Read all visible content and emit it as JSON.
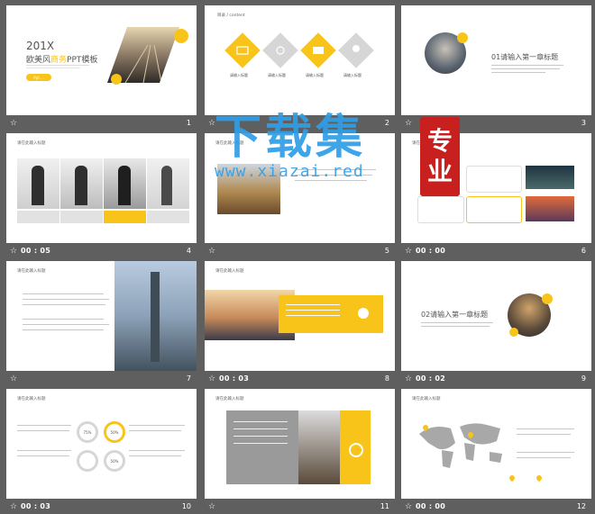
{
  "slides": [
    {
      "number": "1",
      "time": "",
      "title_year": "201X",
      "subtitle_pre": "欧美风",
      "subtitle_hl": "商务",
      "subtitle_post": "PPT模板",
      "button": "Ppt...."
    },
    {
      "number": "2",
      "time": "",
      "header": "目录 / content",
      "items": [
        "请输入标题",
        "请输入标题",
        "请输入标题",
        "请输入标题"
      ]
    },
    {
      "number": "3",
      "time": "",
      "heading": "01请输入第一章标题"
    },
    {
      "number": "4",
      "time": "00 : 05",
      "header": "请在此输入标题"
    },
    {
      "number": "5",
      "time": "",
      "header": "请在此输入标题"
    },
    {
      "number": "6",
      "time": "00 : 00",
      "header": "请在此输入标题"
    },
    {
      "number": "7",
      "time": "",
      "header": "请在此输入标题"
    },
    {
      "number": "8",
      "time": "00 : 03",
      "header": "请在此输入标题"
    },
    {
      "number": "9",
      "time": "00 : 02",
      "heading": "02请输入第一章标题"
    },
    {
      "number": "10",
      "time": "00 : 03",
      "header": "请在此输入标题",
      "percents": [
        "75%",
        "50%",
        "50%"
      ]
    },
    {
      "number": "11",
      "time": "",
      "header": "请在此输入标题"
    },
    {
      "number": "12",
      "time": "00 : 00",
      "header": "请在此输入标题"
    }
  ],
  "watermark": {
    "title": "下载集",
    "url": "www.xiazai.red",
    "seal_top": "专",
    "seal_bottom": "业"
  },
  "colors": {
    "accent": "#f9c41a",
    "background": "#5f5f5f",
    "bar_text": "#ffffff",
    "watermark": "#2f9ee8",
    "seal": "#c81f1f"
  },
  "icons": {
    "bar_icon": "star-icon"
  }
}
